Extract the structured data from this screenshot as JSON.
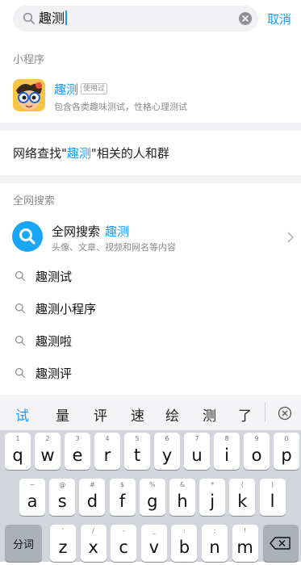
{
  "search": {
    "query": "趣测",
    "cancel_label": "取消"
  },
  "mini_program": {
    "section_title": "小程序",
    "name": "趣测",
    "used_tag": "使用过",
    "description": "包含各类趣味测试，性格心理测试"
  },
  "network_find": {
    "prefix": "网络查找\"",
    "keyword": "趣测",
    "suffix": "\"相关的人和群"
  },
  "full_search": {
    "section_title": "全网搜索",
    "title": "全网搜索",
    "keyword": "趣测",
    "subtitle": "头像、文章、视频和网名等内容"
  },
  "suggestions": [
    "趣测试",
    "趣测小程序",
    "趣测啦",
    "趣测评"
  ],
  "keyboard": {
    "candidates": [
      "试",
      "量",
      "评",
      "速",
      "绘",
      "测",
      "了"
    ],
    "row1": [
      {
        "hint": "1",
        "letter": "q"
      },
      {
        "hint": "2",
        "letter": "w"
      },
      {
        "hint": "3",
        "letter": "e"
      },
      {
        "hint": "4",
        "letter": "r"
      },
      {
        "hint": "5",
        "letter": "t"
      },
      {
        "hint": "6",
        "letter": "y"
      },
      {
        "hint": "7",
        "letter": "u"
      },
      {
        "hint": "8",
        "letter": "i"
      },
      {
        "hint": "9",
        "letter": "o"
      },
      {
        "hint": "0",
        "letter": "p"
      }
    ],
    "row2": [
      {
        "hint": "~",
        "letter": "a"
      },
      {
        "hint": "@",
        "letter": "s"
      },
      {
        "hint": "#",
        "letter": "d"
      },
      {
        "hint": "$",
        "letter": "f"
      },
      {
        "hint": "%",
        "letter": "g"
      },
      {
        "hint": "&",
        "letter": "h"
      },
      {
        "hint": "*",
        "letter": "j"
      },
      {
        "hint": "(",
        "letter": "k"
      },
      {
        "hint": ")",
        "letter": "l"
      }
    ],
    "row3": [
      {
        "hint": "'",
        "letter": "z"
      },
      {
        "hint": "/",
        "letter": "x"
      },
      {
        "hint": "-",
        "letter": "c"
      },
      {
        "hint": "_",
        "letter": "v"
      },
      {
        "hint": ":",
        "letter": "b"
      },
      {
        "hint": ";",
        "letter": "n"
      },
      {
        "hint": "!",
        "letter": "m"
      }
    ],
    "fenci_label": "分词"
  }
}
